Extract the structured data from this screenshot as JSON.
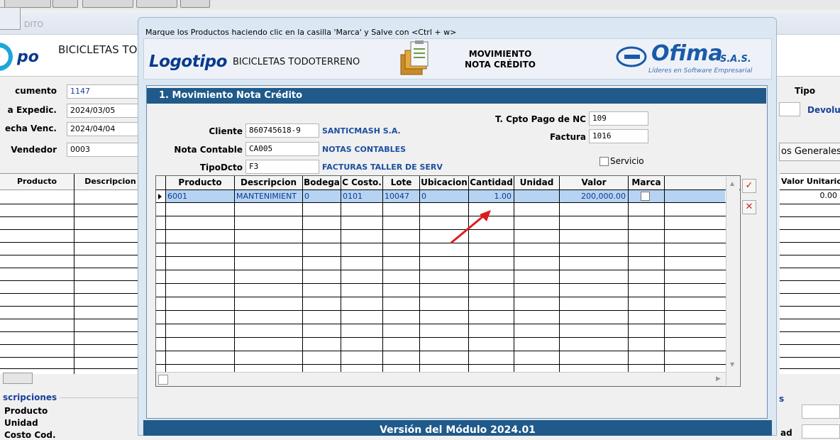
{
  "background_window": {
    "title": "DITO",
    "company": "BICICLETAS TO",
    "logo_partial": "po",
    "fields": [
      {
        "label": "cumento",
        "value": "1147"
      },
      {
        "label": "a Expedic.",
        "value": "2024/03/05"
      },
      {
        "label": "echa Venc.",
        "value": "2024/04/04"
      },
      {
        "label": "Vendedor",
        "value": "0003"
      }
    ],
    "right": {
      "tipo_label": "Tipo",
      "tipo_value": "Devolu",
      "datos_button": "os Generales",
      "valor_unitario_header": "Valor Unitario",
      "valor_unitario_first": "0.00",
      "section_s": "s",
      "unidad_label": "ad"
    },
    "grid_headers": [
      "Producto",
      "Descripcion"
    ],
    "bottom_section": {
      "title": "scripciones",
      "labels": [
        "Producto",
        "Unidad",
        "Costo Cod."
      ]
    }
  },
  "modal": {
    "instruction": "Marque los Productos haciendo clic en la casilla 'Marca' y Salve con <Ctrl + w>",
    "logo_text": "Logotipo",
    "company": "BICICLETAS TODOTERRENO",
    "module_title_line1": "MOVIMIENTO",
    "module_title_line2": "NOTA CRÉDITO",
    "ofima_name": "Ofima",
    "ofima_sas": "S.A.S.",
    "ofima_tagline": "Líderes en Software Empresarial",
    "section_title": "1. Movimiento Nota Crédito",
    "form": {
      "cliente_label": "Cliente",
      "cliente_value": "860745618-9",
      "cliente_desc": "SANTICMASH S.A.",
      "nota_label": "Nota Contable",
      "nota_value": "CA005",
      "nota_desc": "NOTAS CONTABLES",
      "tipodcto_label": "TipoDcto",
      "tipodcto_value": "F3",
      "tipodcto_desc": "FACTURAS TALLER DE SERV",
      "cpto_label": "T. Cpto Pago de NC",
      "cpto_value": "109",
      "factura_label": "Factura",
      "factura_value": "1016",
      "servicio_label": "Servicio"
    },
    "grid": {
      "headers": [
        "Producto",
        "Descripcion",
        "Bodega",
        "C Costo.",
        "Lote",
        "Ubicacion",
        "Cantidad",
        "Unidad",
        "Valor",
        "Marca"
      ],
      "rows": [
        {
          "producto": "6001",
          "descripcion": "MANTENIMIENT",
          "bodega": "0",
          "ccosto": "0101",
          "lote": "10047",
          "ubicacion": "0",
          "cantidad": "1.00",
          "unidad": "",
          "valor": "200,000.00",
          "marca": false
        }
      ]
    },
    "footer": "Versión del Módulo 2024.01"
  },
  "colors": {
    "header_blue": "#1f5a8a",
    "link_blue": "#1b4f9e",
    "selected_row": "#b7d3f3",
    "arrow_red": "#e01a1a"
  }
}
